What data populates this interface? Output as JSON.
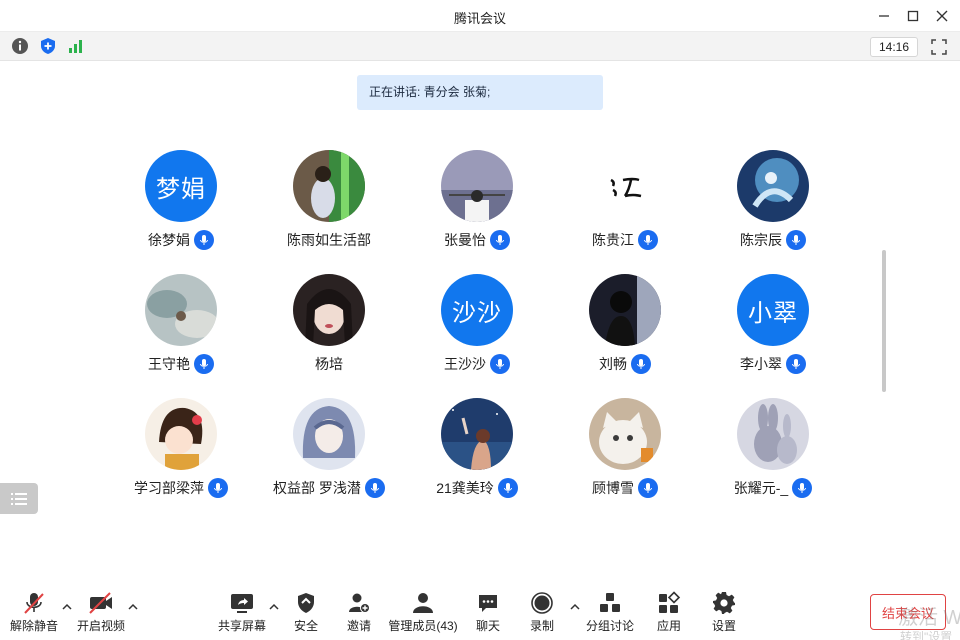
{
  "window": {
    "title": "腾讯会议"
  },
  "toolbar": {
    "clock": "14:16"
  },
  "speaking": {
    "text": "正在讲话: 青分会 张菊;"
  },
  "participants": [
    {
      "name": "徐梦娟",
      "avatar_text": "梦娟",
      "mic": true
    },
    {
      "name": "陈雨如生活部",
      "avatar_text": "",
      "mic": false
    },
    {
      "name": "张曼怡",
      "avatar_text": "",
      "mic": true
    },
    {
      "name": "陈贵江",
      "avatar_text": "",
      "mic": true
    },
    {
      "name": "陈宗辰",
      "avatar_text": "",
      "mic": true
    },
    {
      "name": "王守艳",
      "avatar_text": "",
      "mic": true
    },
    {
      "name": "杨培",
      "avatar_text": "",
      "mic": false
    },
    {
      "name": "王沙沙",
      "avatar_text": "沙沙",
      "mic": true
    },
    {
      "name": "刘畅",
      "avatar_text": "",
      "mic": true
    },
    {
      "name": "李小翠",
      "avatar_text": "小翠",
      "mic": true
    },
    {
      "name": "学习部梁萍",
      "avatar_text": "",
      "mic": true
    },
    {
      "name": "权益部 罗浅潜",
      "avatar_text": "",
      "mic": true
    },
    {
      "name": "21龚美玲",
      "avatar_text": "",
      "mic": true
    },
    {
      "name": "顾博雪",
      "avatar_text": "",
      "mic": true
    },
    {
      "name": "张耀元-_",
      "avatar_text": "",
      "mic": true
    }
  ],
  "bottom": {
    "unmute": "解除静音",
    "start_video": "开启视频",
    "share_screen": "共享屏幕",
    "security": "安全",
    "invite": "邀请",
    "manage_members": "管理成员(43)",
    "chat": "聊天",
    "record": "录制",
    "breakout": "分组讨论",
    "apps": "应用",
    "settings": "设置",
    "end_meeting": "结束会议"
  },
  "watermark": {
    "line1": "激活 W",
    "line2": "转到\"设置"
  },
  "colors": {
    "accent": "#1177ee",
    "mic": "#1a6cf0",
    "danger": "#e04343",
    "speaking_bg": "#dcebfd"
  }
}
